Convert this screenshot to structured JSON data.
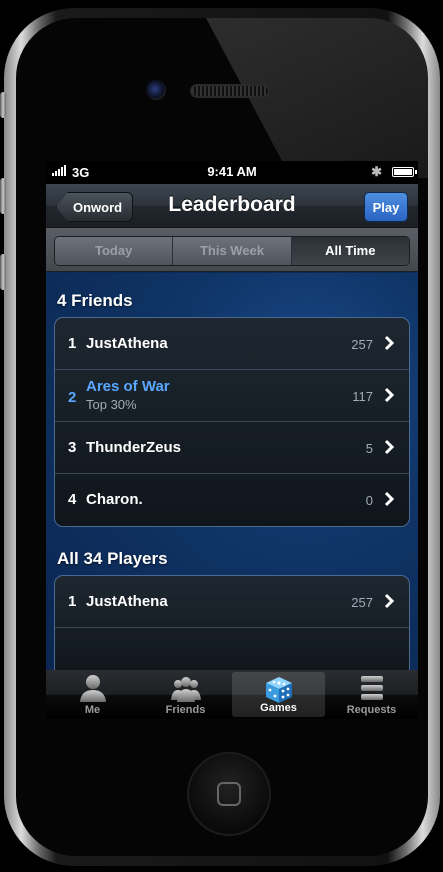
{
  "status_bar": {
    "carrier": "3G",
    "time": "9:41 AM",
    "bluetooth": "✱"
  },
  "nav": {
    "back_label": "Onword",
    "title": "Leaderboard",
    "play_label": "Play"
  },
  "segments": [
    {
      "label": "Today",
      "active": false
    },
    {
      "label": "This Week",
      "active": false
    },
    {
      "label": "All Time",
      "active": true
    }
  ],
  "friends_section": {
    "header": "4 Friends",
    "rows": [
      {
        "rank": "1",
        "name": "JustAthena",
        "sub": "",
        "score": "257",
        "highlight": false
      },
      {
        "rank": "2",
        "name": "Ares of War",
        "sub": "Top 30%",
        "score": "117",
        "highlight": true
      },
      {
        "rank": "3",
        "name": "ThunderZeus",
        "sub": "",
        "score": "5",
        "highlight": false
      },
      {
        "rank": "4",
        "name": "Charon.",
        "sub": "",
        "score": "0",
        "highlight": false
      }
    ]
  },
  "players_section": {
    "header": "All 34 Players",
    "rows": [
      {
        "rank": "1",
        "name": "JustAthena",
        "sub": "",
        "score": "257",
        "highlight": false
      }
    ]
  },
  "tabbar": {
    "tabs": [
      {
        "label": "Me",
        "icon": "person-icon",
        "active": false
      },
      {
        "label": "Friends",
        "icon": "people-icon",
        "active": false
      },
      {
        "label": "Games",
        "icon": "dice-icon",
        "active": true
      },
      {
        "label": "Requests",
        "icon": "stack-icon",
        "active": false
      }
    ]
  },
  "colors": {
    "accent": "#5aa7ff",
    "play_button": "#2a64c2",
    "background": "#0c2a55"
  }
}
